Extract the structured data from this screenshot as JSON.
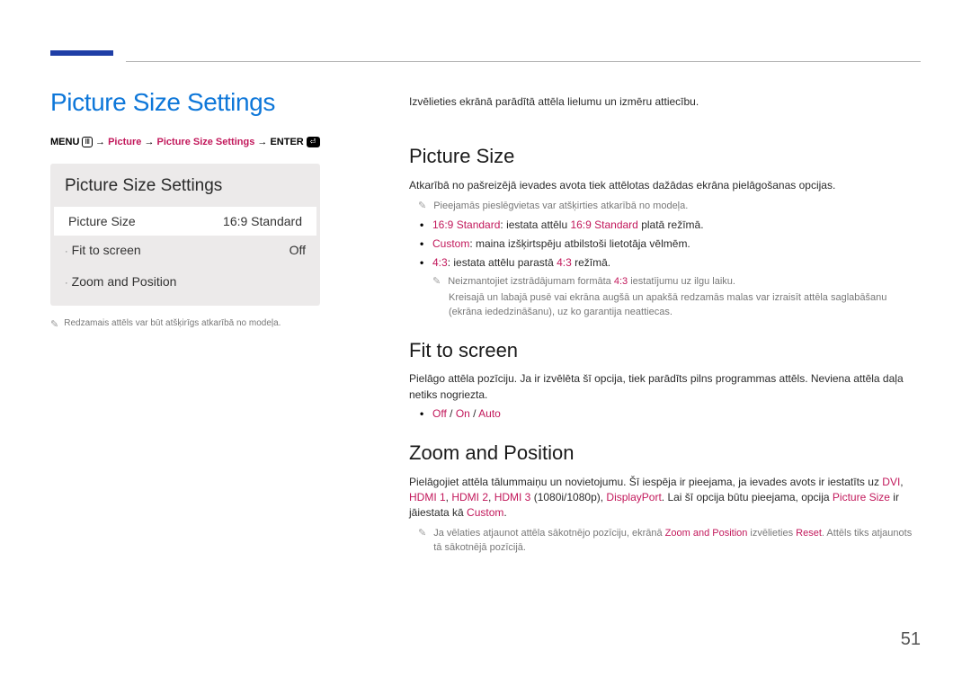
{
  "pageNumber": "51",
  "left": {
    "title": "Picture Size Settings",
    "breadcrumb": {
      "menu": "MENU",
      "p1": "Picture",
      "p2": "Picture Size Settings",
      "enter": "ENTER",
      "arrow": "→"
    },
    "panel": {
      "title": "Picture Size Settings",
      "rows": [
        {
          "label": "Picture Size",
          "value": "16:9 Standard",
          "selected": true,
          "dot": false
        },
        {
          "label": "Fit to screen",
          "value": "Off",
          "selected": false,
          "dot": true
        },
        {
          "label": "Zoom and Position",
          "value": "",
          "selected": false,
          "dot": true
        }
      ]
    },
    "note": "Redzamais attēls var būt atšķirīgs atkarībā no modeļa."
  },
  "right": {
    "intro": "Izvēlieties ekrānā parādītā attēla lielumu un izmēru attiecību.",
    "sec1": {
      "heading": "Picture Size",
      "para": "Atkarībā no pašreizējā ievades avota tiek attēlotas dažādas ekrāna pielāgošanas opcijas.",
      "note1": "Pieejamās pieslēgvietas var atšķirties atkarībā no modeļa.",
      "b1a": "16:9 Standard",
      "b1b": ": iestata attēlu ",
      "b1c": "16:9 Standard",
      "b1d": " platā režīmā.",
      "b2a": "Custom",
      "b2b": ": maina izšķirtspēju atbilstoši lietotāja vēlmēm.",
      "b3a": "4:3",
      "b3b": ": iestata attēlu parastā ",
      "b3c": "4:3",
      "b3d": " režīmā.",
      "sub1a": "Neizmantojiet izstrādājumam formāta ",
      "sub1b": "4:3",
      "sub1c": " iestatījumu uz ilgu laiku.",
      "sub2": "Kreisajā un labajā pusē vai ekrāna augšā un apakšā redzamās malas var izraisīt attēla saglabāšanu (ekrāna iededzināšanu), uz ko garantija neattiecas."
    },
    "sec2": {
      "heading": "Fit to screen",
      "para": "Pielāgo attēla pozīciju. Ja ir izvēlēta šī opcija, tiek parādīts pilns programmas attēls. Neviena attēla daļa netiks nogriezta.",
      "opts_off": "Off",
      "opts_on": "On",
      "opts_auto": "Auto",
      "slash": " / "
    },
    "sec3": {
      "heading": "Zoom and Position",
      "p1a": "Pielāgojiet attēla tālummaiņu un novietojumu. Šī iespēja ir pieejama, ja ievades avots ir iestatīts uz ",
      "p1_dvi": "DVI",
      "p1_c1": ", ",
      "p1_h1": "HDMI 1",
      "p1_c2": ", ",
      "p1_h2": "HDMI 2",
      "p1_c3": ", ",
      "p1_h3": "HDMI 3",
      "p1_r": " (1080i/1080p), ",
      "p1_dp": "DisplayPort",
      "p1_t2": ". Lai šī opcija būtu pieejama, opcija ",
      "p1_ps": "Picture Size",
      "p1_t3": " ir jāiestata kā ",
      "p1_cu": "Custom",
      "p1_dot": ".",
      "n1a": "Ja vēlaties atjaunot attēla sākotnējo pozīciju, ekrānā ",
      "n1_zp": "Zoom and Position",
      "n1b": " izvēlieties ",
      "n1_reset": "Reset",
      "n1c": ". Attēls tiks atjaunots tā sākotnējā pozīcijā."
    }
  }
}
